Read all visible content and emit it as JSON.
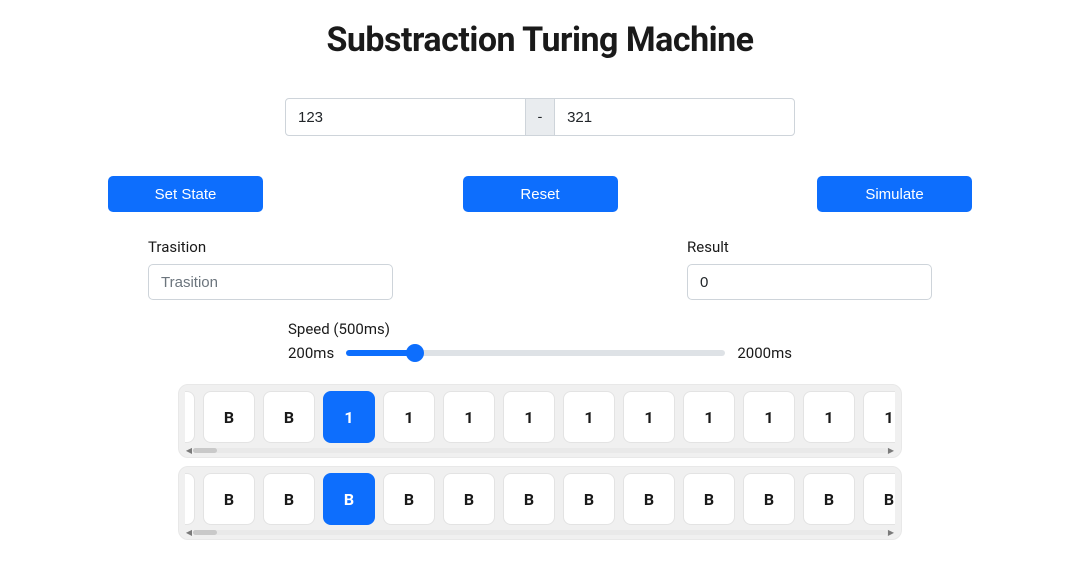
{
  "title": "Substraction Turing Machine",
  "operands": {
    "first_value": "123",
    "separator": "-",
    "second_value": "321"
  },
  "buttons": {
    "set_state": "Set State",
    "reset": "Reset",
    "simulate": "Simulate"
  },
  "transition": {
    "label": "Trasition",
    "placeholder": "Trasition",
    "value": ""
  },
  "result": {
    "label": "Result",
    "value": "0"
  },
  "speed": {
    "label": "Speed (500ms)",
    "min_label": "200ms",
    "max_label": "2000ms",
    "min": 200,
    "max": 2000,
    "value": 500
  },
  "tapes": [
    {
      "head_index": 2,
      "cells": [
        "B",
        "B",
        "1",
        "1",
        "1",
        "1",
        "1",
        "1",
        "1",
        "1",
        "1",
        "1"
      ]
    },
    {
      "head_index": 2,
      "cells": [
        "B",
        "B",
        "B",
        "B",
        "B",
        "B",
        "B",
        "B",
        "B",
        "B",
        "B",
        "B"
      ]
    }
  ]
}
